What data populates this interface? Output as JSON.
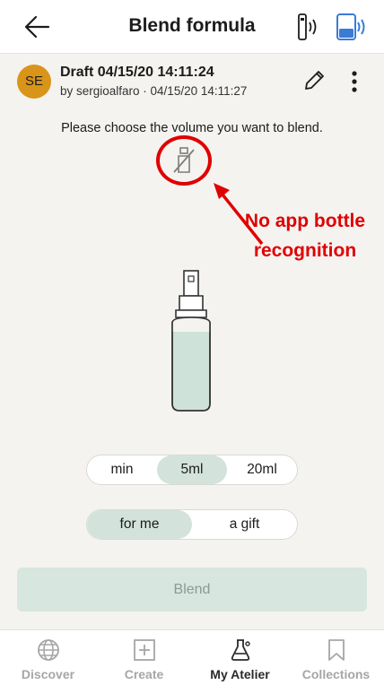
{
  "header": {
    "title": "Blend formula"
  },
  "draft": {
    "avatar_initials": "SE",
    "title": "Draft 04/15/20 14:11:24",
    "subtitle": "by sergioalfaro · 04/15/20 14:11:27"
  },
  "prompt": "Please choose the volume you want to blend.",
  "annotation": {
    "text": "No app bottle recognition",
    "color": "#e00000"
  },
  "volume_options": [
    "min",
    "5ml",
    "20ml"
  ],
  "volume_selected": "5ml",
  "recipient_options": [
    "for me",
    "a gift"
  ],
  "recipient_selected": "for me",
  "blend_button": "Blend",
  "tabs": [
    {
      "label": "Discover",
      "icon": "globe-icon"
    },
    {
      "label": "Create",
      "icon": "plus-square-icon"
    },
    {
      "label": "My Atelier",
      "icon": "flask-icon"
    },
    {
      "label": "Collections",
      "icon": "bookmark-icon"
    }
  ],
  "active_tab": "My Atelier",
  "colors": {
    "accent": "#3a7bd5",
    "avatar": "#d9951a",
    "selected_segment": "#d3e3dc",
    "blend_button": "#d7e6df",
    "bottle_liquid": "#cfe2d9"
  }
}
